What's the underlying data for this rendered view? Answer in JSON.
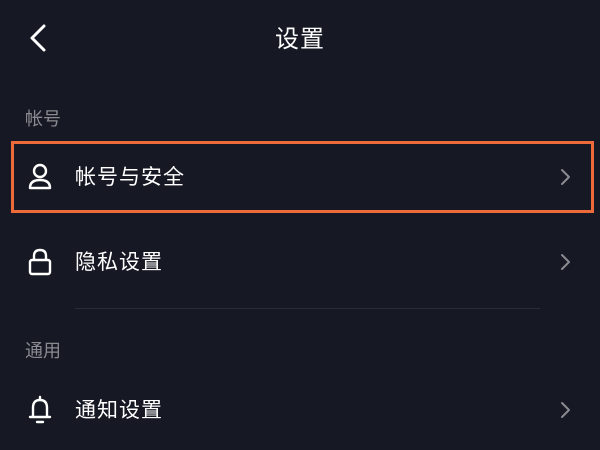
{
  "header": {
    "title": "设置",
    "back_icon": "chevron-left-icon"
  },
  "sections": [
    {
      "label": "帐号",
      "items": [
        {
          "label": "帐号与安全",
          "icon": "user-icon",
          "highlighted": true
        },
        {
          "label": "隐私设置",
          "icon": "lock-icon",
          "highlighted": false
        }
      ]
    },
    {
      "label": "通用",
      "items": [
        {
          "label": "通知设置",
          "icon": "bell-icon",
          "highlighted": false
        }
      ]
    }
  ],
  "colors": {
    "background": "#161823",
    "text": "#ffffff",
    "section_label": "#8a8b91",
    "chevron": "#8a8b91",
    "highlight": "#ef6a3a",
    "divider": "#2a2c36"
  }
}
